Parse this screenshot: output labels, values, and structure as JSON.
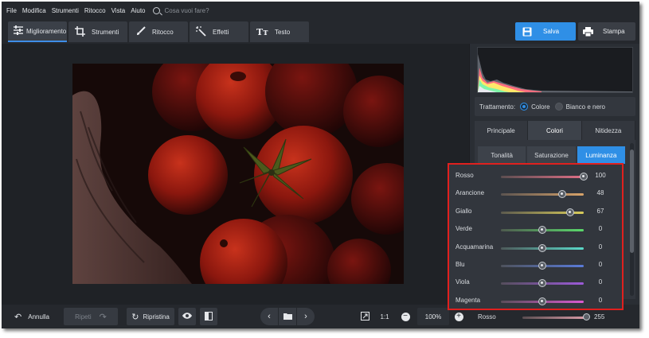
{
  "menu": [
    "File",
    "Modifica",
    "Strumenti",
    "Ritocco",
    "Vista",
    "Aiuto"
  ],
  "search": {
    "placeholder": "Cosa vuoi fare?",
    "icon": "search-icon"
  },
  "toolbar": {
    "tabs": [
      {
        "label": "Miglioramento",
        "icon": "sliders-icon",
        "active": true
      },
      {
        "label": "Strumenti",
        "icon": "crop-icon",
        "active": false
      },
      {
        "label": "Ritocco",
        "icon": "brush-icon",
        "active": false
      },
      {
        "label": "Effetti",
        "icon": "magic-wand-icon",
        "active": false
      },
      {
        "label": "Testo",
        "icon": "text-icon",
        "active": false
      }
    ],
    "save_label": "Salva",
    "print_label": "Stampa",
    "accent": "#2f8fe6"
  },
  "bottom": {
    "undo_label": "Annulla",
    "redo_label": "Ripeti",
    "reset_label": "Ripristina",
    "zoom_ratio": "1:1",
    "zoom_value": "100%"
  },
  "panel": {
    "treatment_label": "Trattamento:",
    "treatment_options": [
      "Colore",
      "Bianco e nero"
    ],
    "treatment_selected": "Colore",
    "main_tabs": [
      "Principale",
      "Colori",
      "Nitidezza"
    ],
    "main_tab_active": "Colori",
    "sub_tabs": [
      "Tonalità",
      "Saturazione",
      "Luminanza"
    ],
    "sub_tab_active": "Luminanza",
    "sliders": [
      {
        "label": "Rosso",
        "value": "100",
        "level": 1.0
      },
      {
        "label": "Arancione",
        "value": "48",
        "level": 0.74
      },
      {
        "label": "Giallo",
        "value": "67",
        "level": 0.835
      },
      {
        "label": "Verde",
        "value": "0",
        "level": 0.5
      },
      {
        "label": "Acquamarina",
        "value": "0",
        "level": 0.5
      },
      {
        "label": "Blu",
        "value": "0",
        "level": 0.5
      },
      {
        "label": "Viola",
        "value": "0",
        "level": 0.5
      },
      {
        "label": "Magenta",
        "value": "0",
        "level": 0.5
      }
    ],
    "below_slider": {
      "label": "Rosso",
      "value": "255",
      "level": 1.0
    },
    "highlight_color": "#e0201e"
  }
}
